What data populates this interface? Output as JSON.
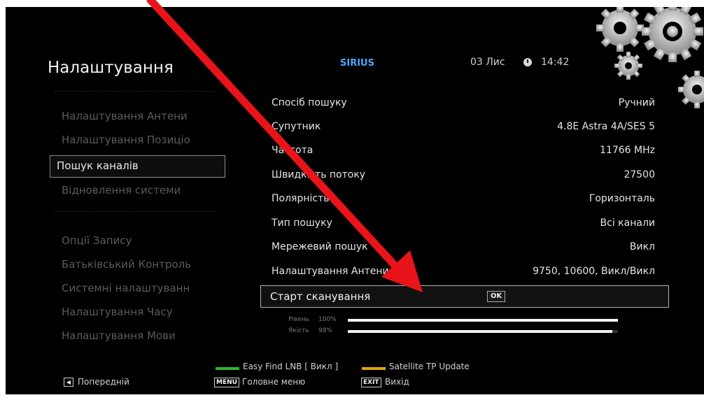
{
  "header": {
    "title": "Налаштування",
    "channel": "SIRIUS",
    "date": "03 Лис",
    "time": "14:42"
  },
  "sidebar": {
    "items": [
      {
        "label": "Налаштування Антени",
        "selected": false
      },
      {
        "label": "Налаштування Позиціо",
        "selected": false
      },
      {
        "label": "Пошук каналів",
        "selected": true
      },
      {
        "label": "Відновлення системи",
        "selected": false
      },
      {
        "label": "Опції Запису",
        "selected": false
      },
      {
        "label": "Батьківський Контроль",
        "selected": false
      },
      {
        "label": "Системні налаштуванн",
        "selected": false
      },
      {
        "label": "Налаштування Часу",
        "selected": false
      },
      {
        "label": "Налаштування Мови",
        "selected": false
      }
    ]
  },
  "settings": {
    "rows": [
      {
        "label": "Спосіб пошуку",
        "value": "Ручний"
      },
      {
        "label": "Супутник",
        "value": "4.8E Astra 4A/SES 5"
      },
      {
        "label": "Частота",
        "value": "11766 MHz"
      },
      {
        "label": "Швидкість потоку",
        "value": "27500"
      },
      {
        "label": "Полярність",
        "value": "Горизонталь"
      },
      {
        "label": "Тип пошуку",
        "value": "Всі канали"
      },
      {
        "label": "Мережевий пошук",
        "value": "Викл"
      },
      {
        "label": "Налаштування Антени",
        "value": "9750, 10600, Викл/Викл"
      }
    ],
    "start_scan": {
      "label": "Старт сканування",
      "key": "OK"
    }
  },
  "signal": {
    "level": {
      "label": "Рівень",
      "value_text": "100%",
      "percent": 100
    },
    "quality": {
      "label": "Якість",
      "value_text": "98%",
      "percent": 98
    }
  },
  "footer": {
    "green_label": "Easy Find LNB [ Викл ]",
    "yellow_label": "Satellite TP Update",
    "prev_label": "Попередній",
    "menu_key": "MENU",
    "menu_label": "Головне меню",
    "exit_key": "EXIT",
    "exit_label": "Вихід"
  },
  "colors": {
    "background": "#000000",
    "channel": "#4aa8ff",
    "annotation_arrow": "#e8141a",
    "green_key": "#2fb52f",
    "yellow_key": "#e0a800"
  }
}
